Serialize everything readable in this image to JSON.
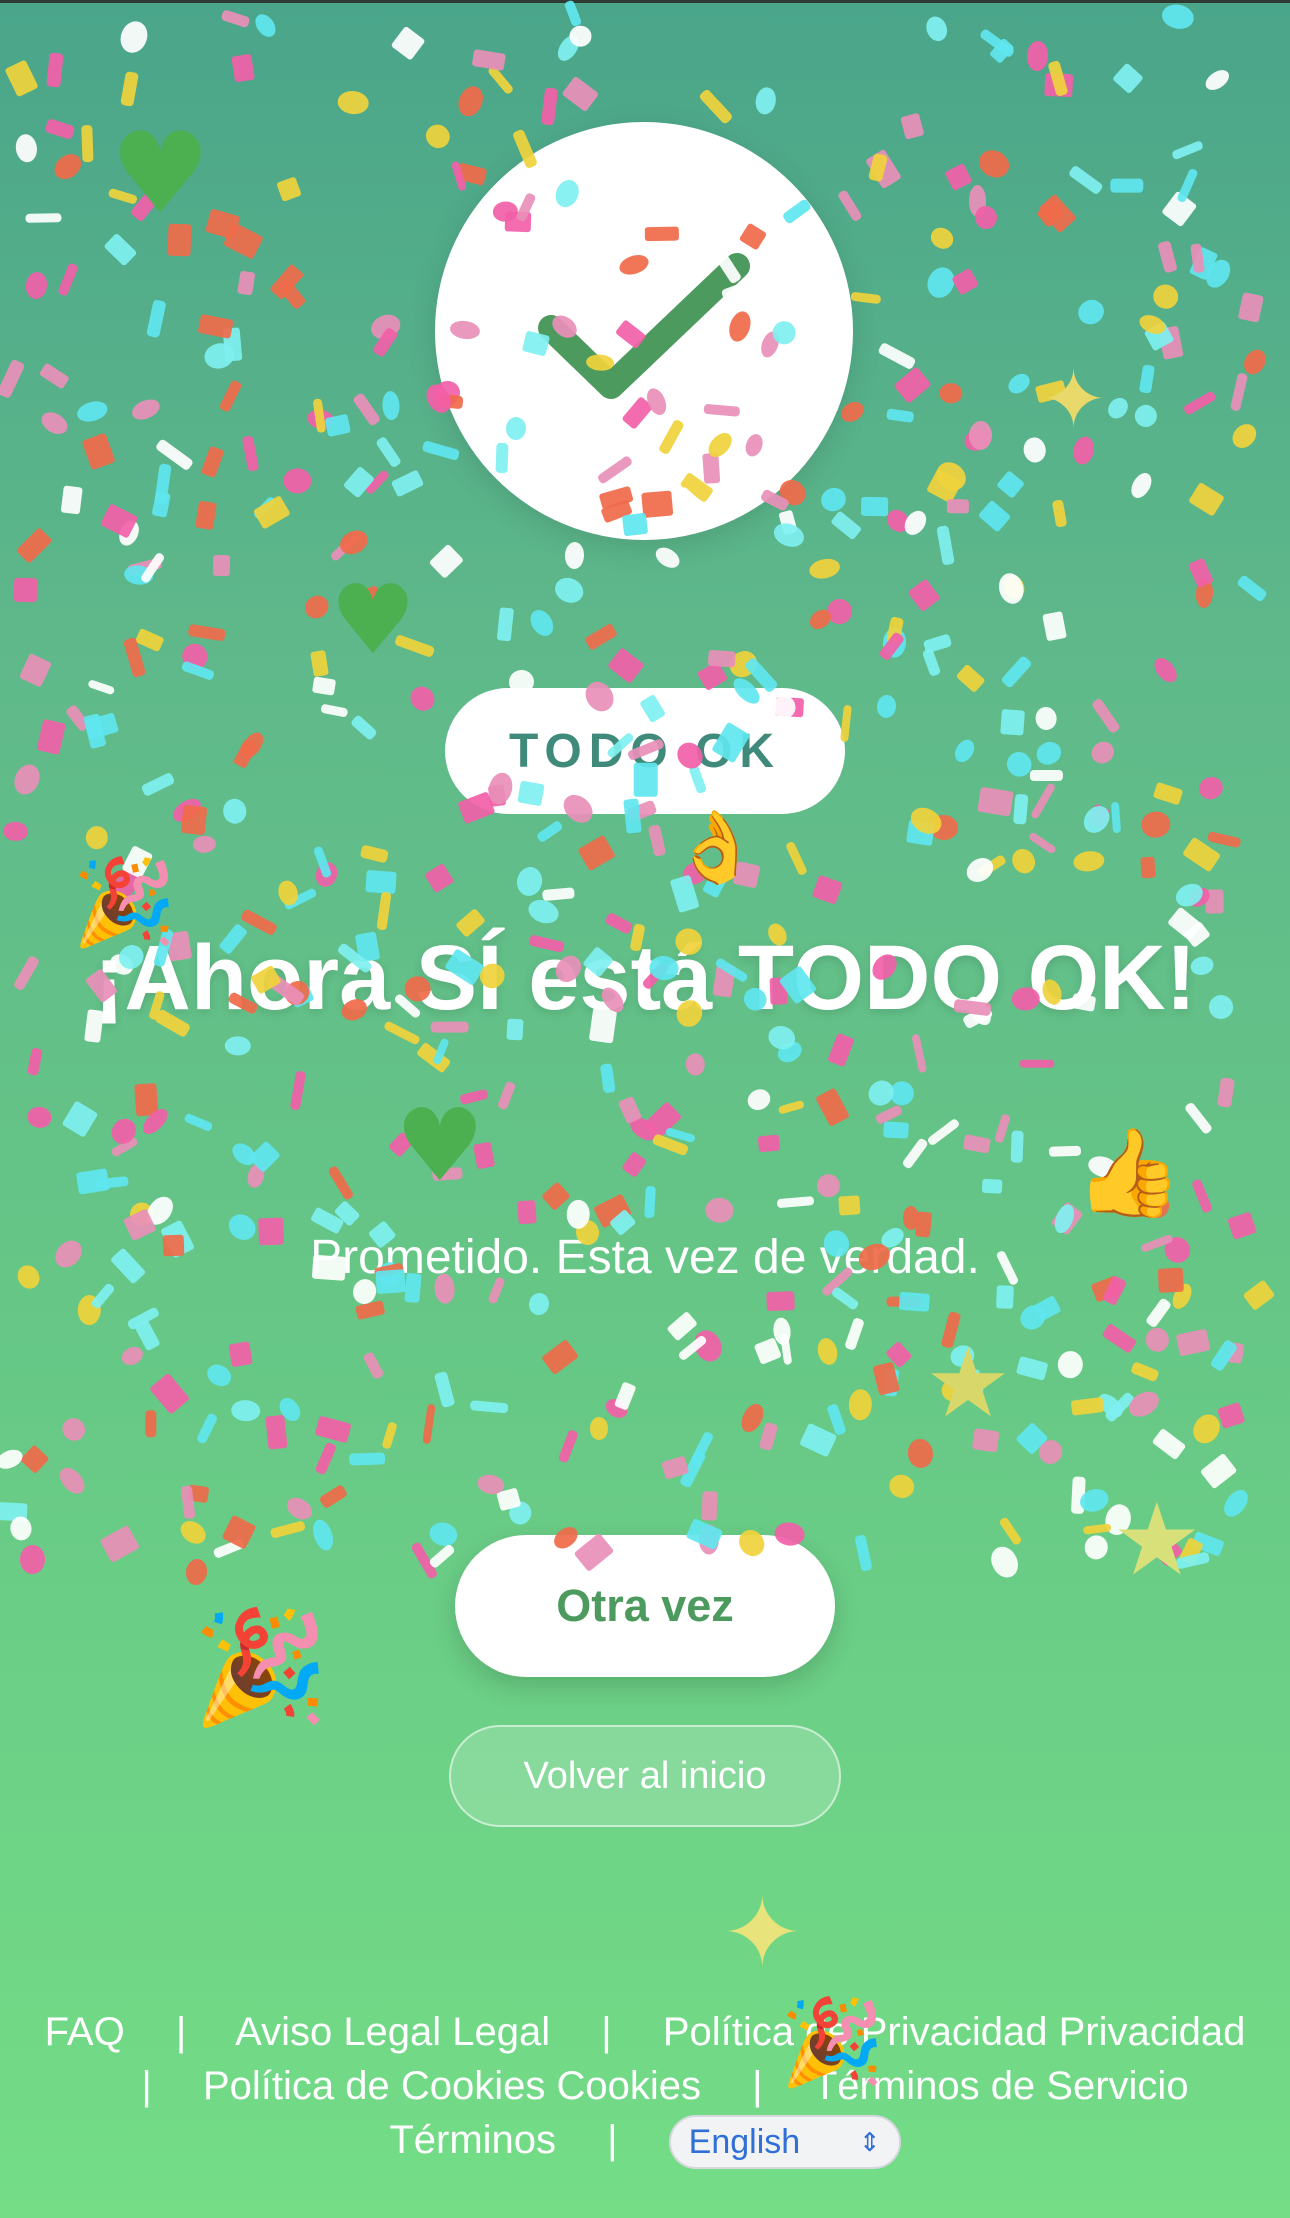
{
  "status": {
    "badge": "TODO OK",
    "headline": "¡Ahora SÍ está TODO OK!",
    "subtitle": "Prometido. Esta vez de verdad."
  },
  "icons": {
    "success": "checkmark-icon"
  },
  "actions": {
    "primary_label": "Otra vez",
    "secondary_label": "Volver al inicio"
  },
  "footer": {
    "links": [
      "FAQ",
      "Aviso Legal Legal",
      "Política de Privacidad Privacidad",
      "Política de Cookies Cookies",
      "Términos de Servicio Términos"
    ],
    "separator": "|",
    "language": "English"
  },
  "decorations": [
    "green-heart",
    "party-popper",
    "sparkles",
    "star",
    "thumbs-up",
    "ok-hand"
  ],
  "colors": {
    "background_top": "#4aa58a",
    "background_bottom": "#74dd86",
    "check": "#4d9a5e",
    "badge_text": "#3f8a7a",
    "language_text": "#2f6fd6"
  }
}
